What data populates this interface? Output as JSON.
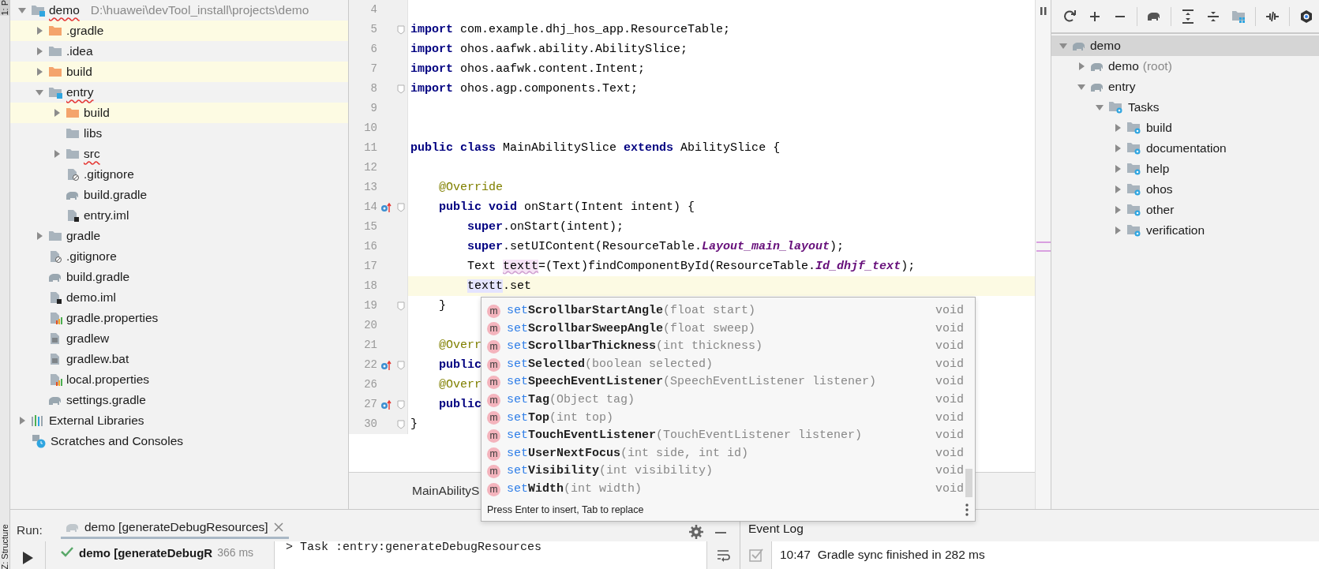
{
  "side_strip": {
    "top_tab": "1: P",
    "bottom_tab": "Z: Structure"
  },
  "project_tree": [
    {
      "label": "demo",
      "path": "D:\\huawei\\devTool_install\\projects\\demo",
      "kind": "module",
      "expanded": true,
      "misspelled": true,
      "highlighted": false,
      "children": [
        {
          "label": ".gradle",
          "kind": "folder-excluded",
          "expanded": false,
          "misspelled": false,
          "highlighted": true
        },
        {
          "label": ".idea",
          "kind": "folder",
          "expanded": false,
          "misspelled": false,
          "highlighted": false
        },
        {
          "label": "build",
          "kind": "folder-excluded",
          "expanded": false,
          "misspelled": false,
          "highlighted": true
        },
        {
          "label": "entry",
          "kind": "module",
          "expanded": true,
          "misspelled": true,
          "highlighted": false,
          "children": [
            {
              "label": "build",
              "kind": "folder-excluded",
              "expanded": false,
              "misspelled": false,
              "highlighted": true
            },
            {
              "label": "libs",
              "kind": "folder",
              "misspelled": false,
              "highlighted": false
            },
            {
              "label": "src",
              "kind": "folder",
              "expanded": false,
              "misspelled": true,
              "highlighted": false
            },
            {
              "label": ".gitignore",
              "kind": "ignore",
              "misspelled": false,
              "highlighted": false
            },
            {
              "label": "build.gradle",
              "kind": "gradle",
              "misspelled": false,
              "highlighted": false
            },
            {
              "label": "entry.iml",
              "kind": "iml",
              "misspelled": false,
              "highlighted": false
            }
          ]
        },
        {
          "label": "gradle",
          "kind": "folder",
          "expanded": false,
          "misspelled": false,
          "highlighted": false
        },
        {
          "label": ".gitignore",
          "kind": "ignore",
          "misspelled": false,
          "highlighted": false
        },
        {
          "label": "build.gradle",
          "kind": "gradle",
          "misspelled": false,
          "highlighted": false
        },
        {
          "label": "demo.iml",
          "kind": "iml",
          "misspelled": false,
          "highlighted": false
        },
        {
          "label": "gradle.properties",
          "kind": "properties",
          "misspelled": false,
          "highlighted": false
        },
        {
          "label": "gradlew",
          "kind": "text",
          "misspelled": false,
          "highlighted": false
        },
        {
          "label": "gradlew.bat",
          "kind": "text",
          "misspelled": false,
          "highlighted": false
        },
        {
          "label": "local.properties",
          "kind": "properties",
          "misspelled": false,
          "highlighted": false
        },
        {
          "label": "settings.gradle",
          "kind": "gradle",
          "misspelled": false,
          "highlighted": false
        }
      ]
    },
    {
      "label": "External Libraries",
      "kind": "libraries",
      "expanded": false,
      "misspelled": false,
      "highlighted": false
    },
    {
      "label": "Scratches and Consoles",
      "kind": "scratches",
      "misspelled": false,
      "highlighted": false
    }
  ],
  "editor": {
    "lines": [
      {
        "number": "4",
        "current": false,
        "fold": false
      },
      {
        "number": "5",
        "current": false,
        "fold": true,
        "tokens": [
          {
            "kind": "keyword",
            "text": "import"
          },
          {
            "kind": "text",
            "text": " com.example.dhj_hos_app.ResourceTable;"
          }
        ]
      },
      {
        "number": "6",
        "current": false,
        "fold": false,
        "tokens": [
          {
            "kind": "keyword",
            "text": "import"
          },
          {
            "kind": "text",
            "text": " ohos.aafwk.ability.AbilitySlice;"
          }
        ]
      },
      {
        "number": "7",
        "current": false,
        "fold": false,
        "tokens": [
          {
            "kind": "keyword",
            "text": "import"
          },
          {
            "kind": "text",
            "text": " ohos.aafwk.content.Intent;"
          }
        ]
      },
      {
        "number": "8",
        "current": false,
        "fold": true,
        "tokens": [
          {
            "kind": "keyword",
            "text": "import"
          },
          {
            "kind": "text",
            "text": " ohos.agp.components.Text;"
          }
        ]
      },
      {
        "number": "9",
        "current": false,
        "fold": false
      },
      {
        "number": "10",
        "current": false,
        "fold": false
      },
      {
        "number": "11",
        "current": false,
        "fold": false,
        "tokens": [
          {
            "kind": "keyword",
            "text": "public class"
          },
          {
            "kind": "text",
            "text": " MainAbilitySlice "
          },
          {
            "kind": "keyword",
            "text": "extends"
          },
          {
            "kind": "text",
            "text": " AbilitySlice {"
          }
        ]
      },
      {
        "number": "12",
        "current": false,
        "fold": false
      },
      {
        "number": "13",
        "current": false,
        "fold": false,
        "tokens": [
          {
            "kind": "annotation",
            "text": "    @Override"
          }
        ]
      },
      {
        "number": "14",
        "current": false,
        "fold": true,
        "overrides": true,
        "tokens": [
          {
            "kind": "keyword",
            "text": "    public void"
          },
          {
            "kind": "text",
            "text": " onStart(Intent intent) {"
          }
        ]
      },
      {
        "number": "15",
        "current": false,
        "fold": false,
        "tokens": [
          {
            "kind": "keyword",
            "text": "        super"
          },
          {
            "kind": "text",
            "text": ".onStart(intent);"
          }
        ]
      },
      {
        "number": "16",
        "current": false,
        "fold": false,
        "tokens": [
          {
            "kind": "keyword",
            "text": "        super"
          },
          {
            "kind": "text",
            "text": ".setUIContent(ResourceTable."
          },
          {
            "kind": "constant",
            "text": "Layout_main_layout"
          },
          {
            "kind": "text",
            "text": ");"
          }
        ]
      },
      {
        "number": "17",
        "current": false,
        "fold": false,
        "tokens": [
          {
            "kind": "text",
            "text": "        Text "
          },
          {
            "kind": "error",
            "text": "textt"
          },
          {
            "kind": "text",
            "text": "=(Text)findComponentById(ResourceTable."
          },
          {
            "kind": "constant",
            "text": "Id_dhjf_text"
          },
          {
            "kind": "text",
            "text": ");"
          }
        ]
      },
      {
        "number": "18",
        "current": true,
        "fold": false,
        "tokens": [
          {
            "kind": "reference",
            "text": "        textt"
          },
          {
            "kind": "text",
            "text": ".set"
          }
        ]
      },
      {
        "number": "19",
        "current": false,
        "fold": true,
        "tokens": [
          {
            "kind": "text",
            "text": "    }"
          }
        ]
      },
      {
        "number": "20",
        "current": false,
        "fold": false
      },
      {
        "number": "21",
        "current": false,
        "fold": false,
        "tokens": [
          {
            "kind": "annotation",
            "text": "    @Overr"
          }
        ]
      },
      {
        "number": "22",
        "current": false,
        "fold": true,
        "overrides": true,
        "tokens": [
          {
            "kind": "keyword",
            "text": "    public"
          }
        ]
      },
      {
        "number": "26",
        "current": false,
        "fold": false,
        "tokens": [
          {
            "kind": "annotation",
            "text": "    @Overr"
          }
        ]
      },
      {
        "number": "27",
        "current": false,
        "fold": true,
        "overrides": true,
        "tokens": [
          {
            "kind": "keyword",
            "text": "    public"
          }
        ]
      },
      {
        "number": "30",
        "current": false,
        "fold": true,
        "tokens": [
          {
            "kind": "text",
            "text": "}"
          }
        ]
      }
    ],
    "tab": {
      "label": "MainAbilityS"
    }
  },
  "completion": {
    "items": [
      {
        "badge": "m",
        "match": "set",
        "name": "ScrollbarStartAngle",
        "params": "(float start)",
        "type": "void"
      },
      {
        "badge": "m",
        "match": "set",
        "name": "ScrollbarSweepAngle",
        "params": "(float sweep)",
        "type": "void"
      },
      {
        "badge": "m",
        "match": "set",
        "name": "ScrollbarThickness",
        "params": "(int thickness)",
        "type": "void"
      },
      {
        "badge": "m",
        "match": "set",
        "name": "Selected",
        "params": "(boolean selected)",
        "type": "void"
      },
      {
        "badge": "m",
        "match": "set",
        "name": "SpeechEventListener",
        "params": "(SpeechEventListener listener)",
        "type": "void"
      },
      {
        "badge": "m",
        "match": "set",
        "name": "Tag",
        "params": "(Object tag)",
        "type": "void"
      },
      {
        "badge": "m",
        "match": "set",
        "name": "Top",
        "params": "(int top)",
        "type": "void"
      },
      {
        "badge": "m",
        "match": "set",
        "name": "TouchEventListener",
        "params": "(TouchEventListener listener)",
        "type": "void"
      },
      {
        "badge": "m",
        "match": "set",
        "name": "UserNextFocus",
        "params": "(int side, int id)",
        "type": "void"
      },
      {
        "badge": "m",
        "match": "set",
        "name": "Visibility",
        "params": "(int visibility)",
        "type": "void"
      },
      {
        "badge": "m",
        "match": "set",
        "name": "Width",
        "params": "(int width)",
        "type": "void"
      }
    ],
    "hint": "Press Enter to insert, Tab to replace"
  },
  "gradle_tree": [
    {
      "label": "demo",
      "kind": "project",
      "selected": true,
      "expanded": true,
      "children": [
        {
          "label": "demo",
          "suffix": "(root)",
          "kind": "project",
          "selected": false,
          "expanded": false
        },
        {
          "label": "entry",
          "kind": "project",
          "selected": false,
          "expanded": true,
          "children": [
            {
              "label": "Tasks",
              "kind": "tasks",
              "selected": false,
              "expanded": true,
              "children": [
                {
                  "label": "build",
                  "kind": "tasks",
                  "selected": false,
                  "expanded": false
                },
                {
                  "label": "documentation",
                  "kind": "tasks",
                  "selected": false,
                  "expanded": false
                },
                {
                  "label": "help",
                  "kind": "tasks",
                  "selected": false,
                  "expanded": false
                },
                {
                  "label": "ohos",
                  "kind": "tasks",
                  "selected": false,
                  "expanded": false
                },
                {
                  "label": "other",
                  "kind": "tasks",
                  "selected": false,
                  "expanded": false
                },
                {
                  "label": "verification",
                  "kind": "tasks",
                  "selected": false,
                  "expanded": false
                }
              ]
            }
          ]
        }
      ]
    }
  ],
  "run_panel": {
    "label": "Run:",
    "tab": {
      "label": "demo [generateDebugResources]",
      "selected": true
    },
    "tree_item": {
      "label": "demo [generateDebugR",
      "time": "366 ms",
      "succeeded": true
    },
    "console": [
      "> Task :entry:generateDebugResources"
    ]
  },
  "event_log": {
    "title": "Event Log",
    "entries": [
      {
        "time": "10:47",
        "message": "Gradle sync finished in 282 ms"
      }
    ]
  }
}
